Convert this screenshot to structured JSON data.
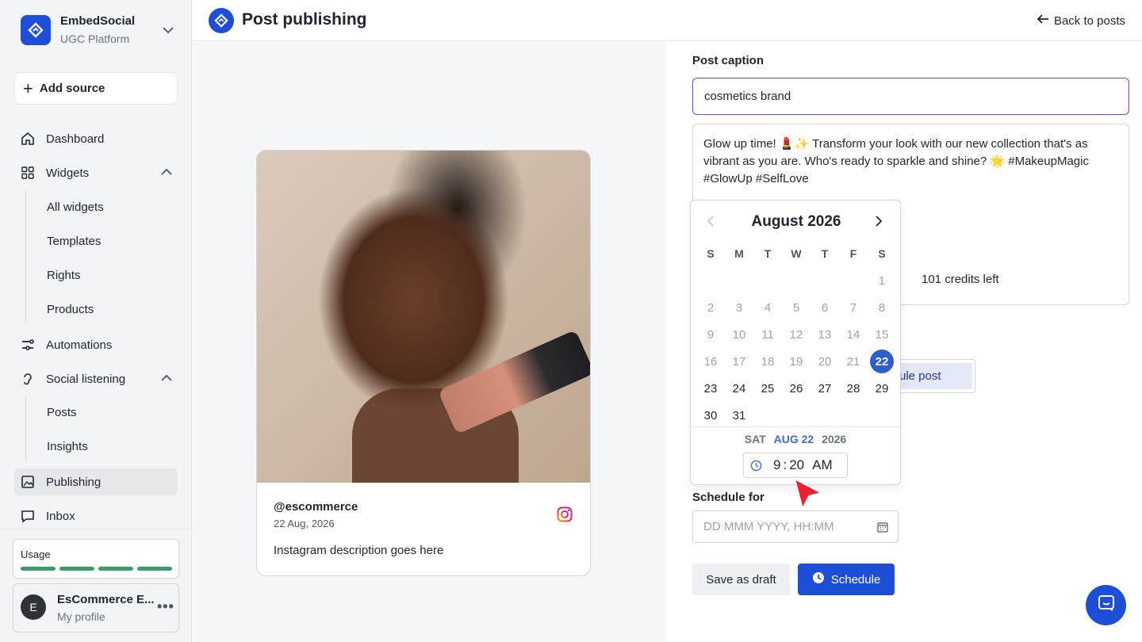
{
  "brand": {
    "name": "EmbedSocial",
    "sub": "UGC Platform"
  },
  "sidebar": {
    "add_source": "Add source",
    "items": [
      {
        "label": "Dashboard"
      },
      {
        "label": "Widgets"
      },
      {
        "label": "Automations"
      },
      {
        "label": "Social listening"
      },
      {
        "label": "Publishing"
      },
      {
        "label": "Inbox"
      }
    ],
    "widgets_sub": [
      "All widgets",
      "Templates",
      "Rights",
      "Products"
    ],
    "listening_sub": [
      "Posts",
      "Insights"
    ],
    "usage_label": "Usage",
    "profile": {
      "initial": "E",
      "name": "EsCommerce E...",
      "sub": "My profile",
      "more": "•••"
    }
  },
  "header": {
    "title": "Post publishing",
    "back": "Back to posts"
  },
  "preview": {
    "user": "@escommerce",
    "date": "22 Aug, 2026",
    "description": "Instagram description goes here"
  },
  "form": {
    "caption_label": "Post caption",
    "caption_value": "cosmetics brand",
    "caption_body": "Glow up time! 💄✨ Transform your look with our new collection that's as vibrant as you are. Who's ready to sparkle and shine? 🌟 #MakeupMagic #GlowUp #SelfLove",
    "credits": "101 credits left",
    "schedule_post_partial": "ule post",
    "schedule_label": "Schedule for",
    "schedule_placeholder": "DD MMM YYYY, HH:MM",
    "draft_button": "Save as draft",
    "schedule_button": "Schedule"
  },
  "datepicker": {
    "month": "August 2026",
    "weekdays": [
      "S",
      "M",
      "T",
      "W",
      "T",
      "F",
      "S"
    ],
    "selected_day": 22,
    "footer": {
      "dow": "SAT",
      "date": "AUG 22",
      "year": "2026"
    },
    "time": {
      "hour": "9",
      "minute": "20",
      "ampm": "AM"
    }
  },
  "colors": {
    "accent": "#1d4ed8",
    "selected": "#2e5cd1",
    "caption_border": "#7c3aed"
  }
}
